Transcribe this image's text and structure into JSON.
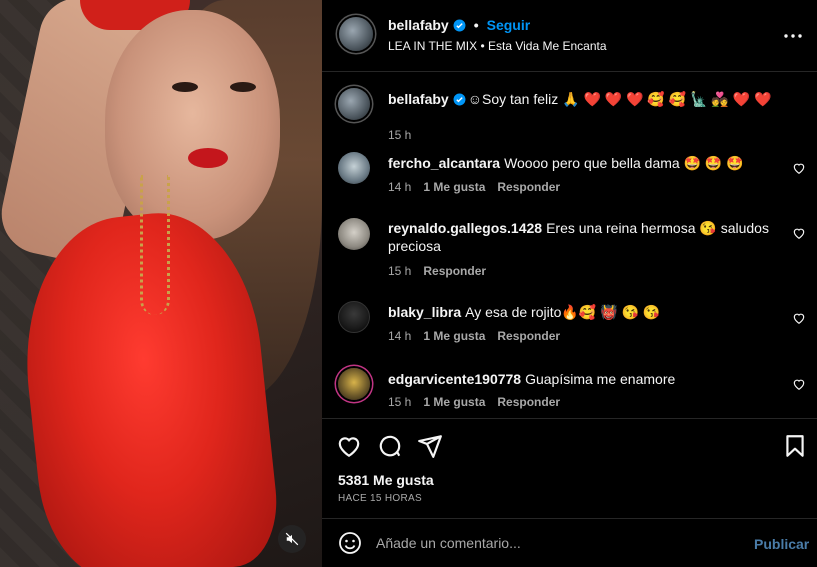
{
  "post": {
    "username": "bellafaby",
    "follow_label": "Seguir",
    "audio": "LEA IN THE MIX • Esta Vida Me Encanta",
    "mute_icon": "mute-icon"
  },
  "caption": {
    "username": "bellafaby",
    "text": "☺Soy tan feliz 🙏 ❤️ ❤️ ❤️ 🥰 🥰 🗽 💑 ❤️ ❤️",
    "time": "15 h"
  },
  "comments": [
    {
      "username": "fercho_alcantara",
      "text": "Woooo pero que bella dama 🤩 🤩 🤩",
      "time": "14 h",
      "likes": "1 Me gusta",
      "reply": "Responder"
    },
    {
      "username": "reynaldo.gallegos.1428",
      "text": "Eres una reina hermosa 😘 saludos preciosa",
      "time": "15 h",
      "likes": "",
      "reply": "Responder"
    },
    {
      "username": "blaky_libra",
      "text": "Ay esa de rojito🔥🥰 👹 😘 😘",
      "time": "14 h",
      "likes": "1 Me gusta",
      "reply": "Responder"
    },
    {
      "username": "edgarvicente190778",
      "text": "Guapísima me enamore",
      "time": "15 h",
      "likes": "1 Me gusta",
      "reply": "Responder"
    }
  ],
  "footer": {
    "likes": "5381 Me gusta",
    "time_ago": "HACE 15 HORAS",
    "comment_placeholder": "Añade un comentario...",
    "post_label": "Publicar"
  },
  "colors": {
    "background": "#000000",
    "accent": "#0095f6",
    "muted": "#a8a8a8",
    "verified": "#0095f6"
  }
}
